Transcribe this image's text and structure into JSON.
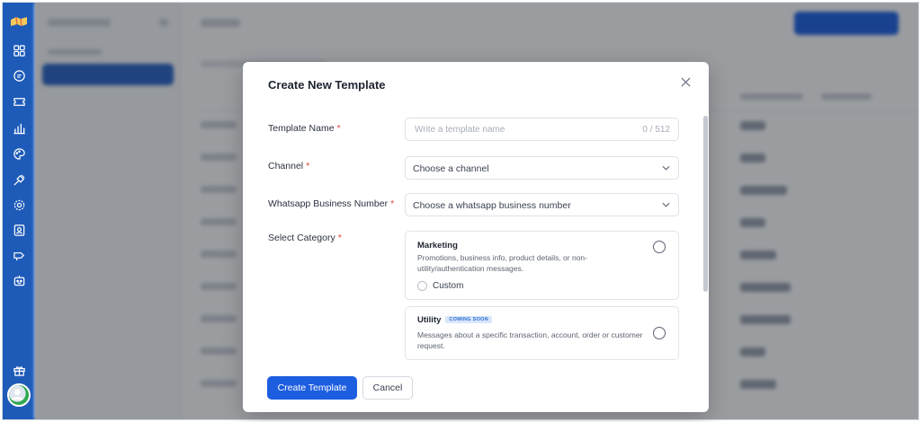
{
  "rail": {
    "icons": [
      "logo-icon",
      "dashboard-icon",
      "chat-icon",
      "ticket-icon",
      "analytics-icon",
      "palette-icon",
      "plug-icon",
      "settings-icon",
      "contacts-icon",
      "campaign-icon",
      "bot-icon",
      "gift-icon",
      "avatar"
    ],
    "accent": "#1e5bb8"
  },
  "modal": {
    "title": "Create New Template",
    "fields": {
      "template_name": {
        "label": "Template Name",
        "required_mark": "*",
        "placeholder": "Write a template name",
        "value": "",
        "counter": "0 / 512"
      },
      "channel": {
        "label": "Channel",
        "required_mark": "*",
        "selected": "Choose a channel"
      },
      "business_number": {
        "label": "Whatsapp Business Number",
        "required_mark": "*",
        "selected": "Choose a whatsapp business number"
      },
      "category": {
        "label": "Select Category",
        "required_mark": "*",
        "options": [
          {
            "title": "Marketing",
            "description": "Promotions, business info, product details, or non-utility/authentication messages.",
            "sub_option": "Custom"
          },
          {
            "title": "Utility",
            "badge": "COMING SOON",
            "description": "Messages about a specific transaction, account, order or customer request."
          }
        ]
      }
    },
    "buttons": {
      "create": "Create Template",
      "cancel": "Cancel"
    }
  },
  "colors": {
    "primary": "#1d5ee0",
    "required": "#e2403a",
    "badge_bg": "#d8e7fb",
    "badge_text": "#2f6fd0"
  }
}
